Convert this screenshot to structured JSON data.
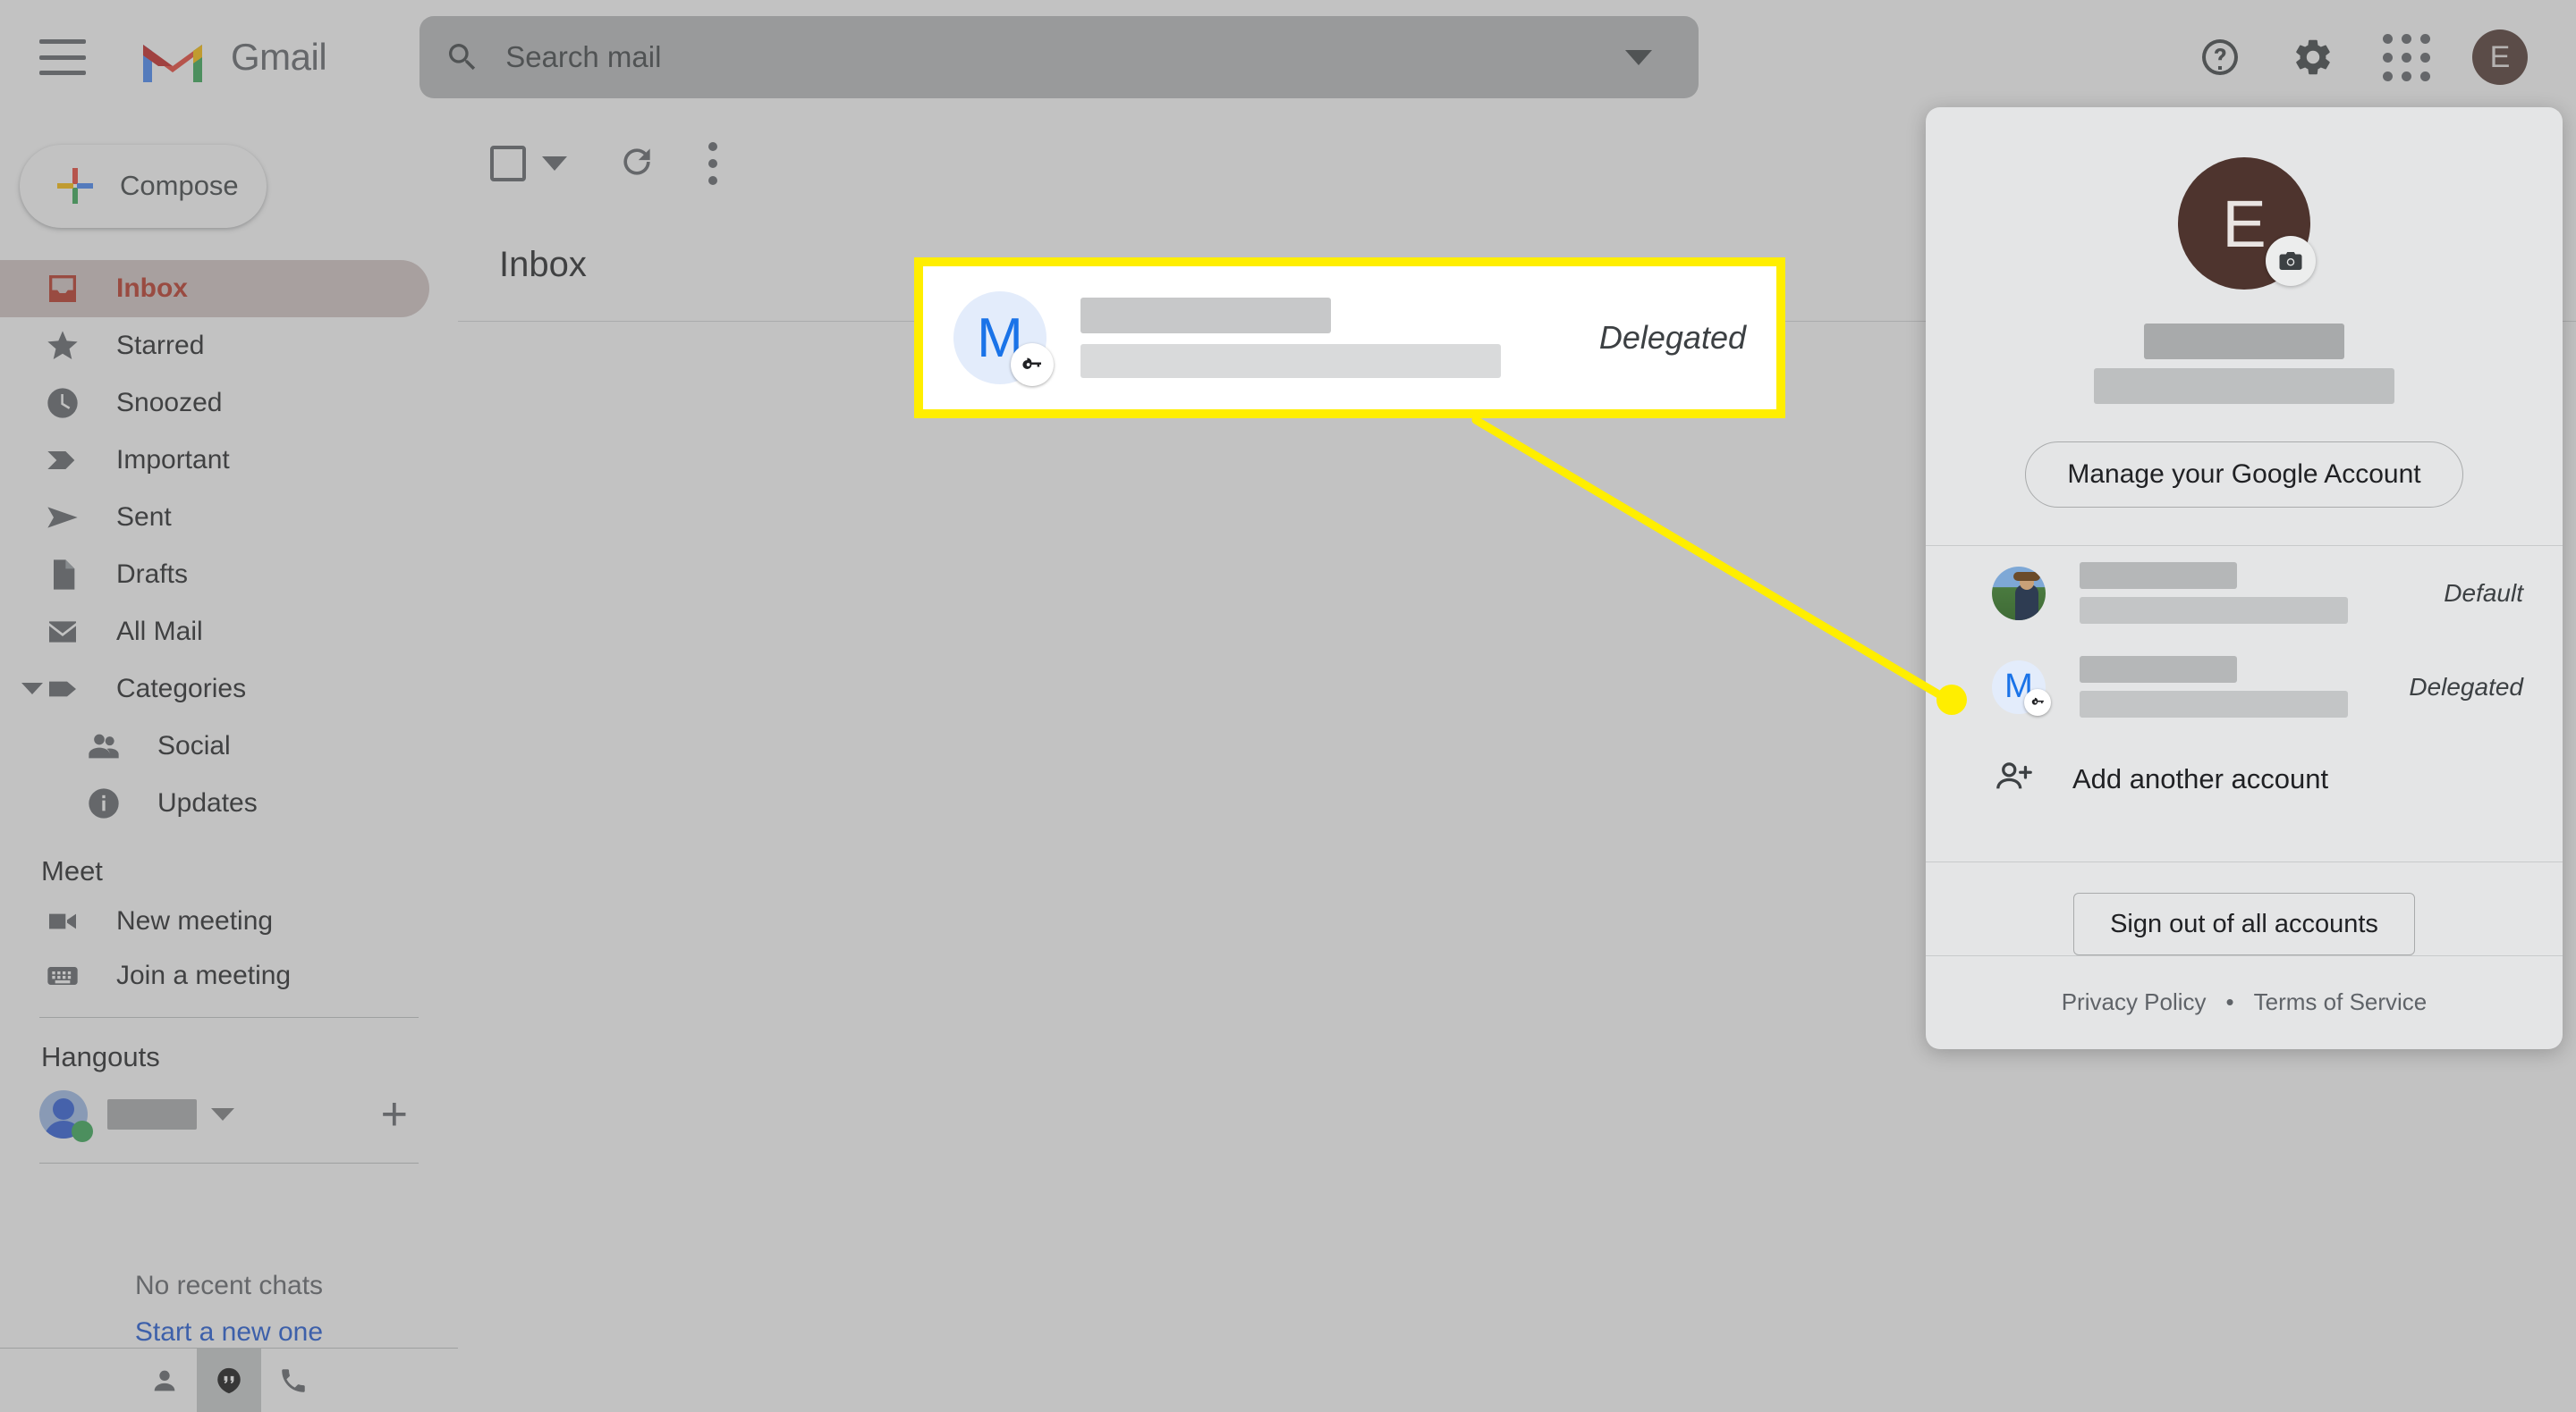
{
  "app": {
    "title": "Gmail"
  },
  "header": {
    "menu_icon": "hamburger-menu-icon",
    "logo_icon": "gmail-logo-icon",
    "brand": "Gmail",
    "search": {
      "placeholder": "Search mail",
      "icon": "search-icon",
      "options_icon": "chevron-down-icon"
    },
    "help_icon": "help-question-icon",
    "settings_icon": "gear-icon",
    "apps_icon": "apps-grid-icon",
    "avatar_initial": "E"
  },
  "sidebar": {
    "compose": {
      "label": "Compose",
      "icon": "plus-icon"
    },
    "items": [
      {
        "label": "Inbox",
        "icon": "inbox-icon",
        "active": true
      },
      {
        "label": "Starred",
        "icon": "star-icon",
        "active": false
      },
      {
        "label": "Snoozed",
        "icon": "clock-icon",
        "active": false
      },
      {
        "label": "Important",
        "icon": "important-marker-icon",
        "active": false
      },
      {
        "label": "Sent",
        "icon": "send-icon",
        "active": false
      },
      {
        "label": "Drafts",
        "icon": "draft-page-icon",
        "active": false
      },
      {
        "label": "All Mail",
        "icon": "mail-envelope-icon",
        "active": false
      },
      {
        "label": "Categories",
        "icon": "label-tag-icon",
        "active": false
      },
      {
        "label": "Social",
        "icon": "people-icon",
        "active": false
      },
      {
        "label": "Updates",
        "icon": "info-icon",
        "active": false
      }
    ],
    "meet": {
      "title": "Meet",
      "items": [
        {
          "label": "New meeting",
          "icon": "video-camera-icon"
        },
        {
          "label": "Join a meeting",
          "icon": "keyboard-icon"
        }
      ]
    },
    "hangouts": {
      "title": "Hangouts",
      "status_icon": "online-status-dot",
      "caret_icon": "chevron-down-icon",
      "add_icon": "plus-icon",
      "no_chats": "No recent chats",
      "start_new": "Start a new one"
    },
    "bottom_tabs": [
      {
        "icon": "person-icon",
        "selected": false
      },
      {
        "icon": "hangouts-quote-icon",
        "selected": true
      },
      {
        "icon": "phone-icon",
        "selected": false
      }
    ]
  },
  "main": {
    "toolbar": {
      "select_all_icon": "checkbox-icon",
      "select_caret_icon": "chevron-down-icon",
      "refresh_icon": "refresh-icon",
      "more_icon": "more-vertical-icon"
    },
    "inbox_title": "Inbox"
  },
  "callout": {
    "avatar_initial": "M",
    "badge_icon": "key-icon",
    "tag": "Delegated",
    "border_color": "#ffee00"
  },
  "account_panel": {
    "avatar_initial": "E",
    "avatar_color": "#4e342e",
    "camera_icon": "camera-icon",
    "manage_button": "Manage your Google Account",
    "accounts": [
      {
        "avatar_type": "photo",
        "tag": "Default",
        "badge_icon": ""
      },
      {
        "avatar_type": "initial",
        "avatar_initial": "M",
        "tag": "Delegated",
        "badge_icon": "key-icon"
      }
    ],
    "add_account": {
      "label": "Add another account",
      "icon": "person-add-icon"
    },
    "sign_out": "Sign out of all accounts",
    "footer": {
      "privacy": "Privacy Policy",
      "separator": "•",
      "terms": "Terms of Service"
    }
  }
}
